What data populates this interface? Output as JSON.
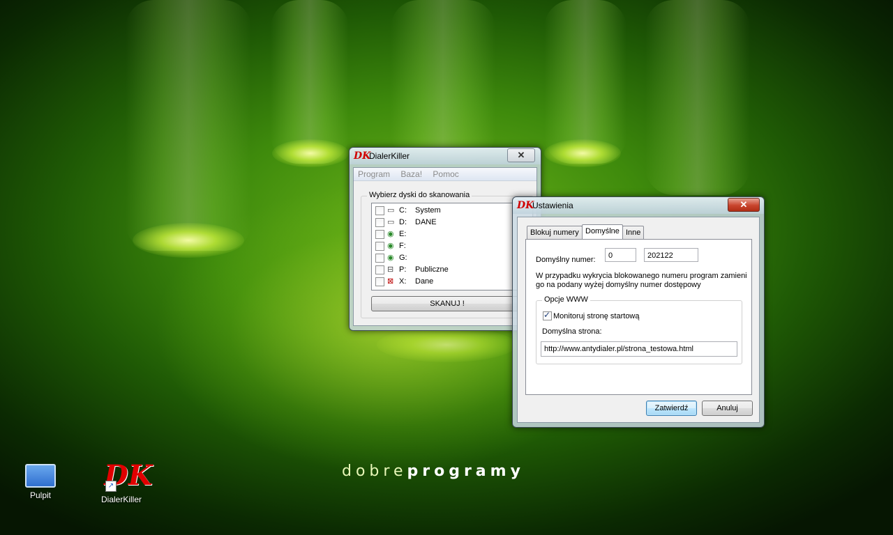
{
  "desktop": {
    "brand_light": "dobre",
    "brand_bold": "programy",
    "icons": [
      {
        "label": "Pulpit"
      },
      {
        "label": "DialerKiller"
      }
    ]
  },
  "main_window": {
    "title": "DialerKiller",
    "close_glyph": "✕",
    "menu": [
      "Program",
      "Baza!",
      "Pomoc"
    ],
    "group_label": "Wybierz dyski do skanowania",
    "drives": [
      {
        "letter": "C:",
        "label": "System",
        "icon": "hdd-icon"
      },
      {
        "letter": "D:",
        "label": "DANE",
        "icon": "hdd-icon"
      },
      {
        "letter": "E:",
        "label": "",
        "icon": "cdrom-icon"
      },
      {
        "letter": "F:",
        "label": "",
        "icon": "cdrom-icon"
      },
      {
        "letter": "G:",
        "label": "",
        "icon": "cdrom-icon"
      },
      {
        "letter": "P:",
        "label": "Publiczne",
        "icon": "network-drive-icon"
      },
      {
        "letter": "X:",
        "label": "Dane",
        "icon": "network-drive-icon"
      }
    ],
    "scan_button": "SKANUJ !"
  },
  "settings_window": {
    "title": "Ustawienia",
    "close_glyph": "✕",
    "tabs": [
      "Blokuj numery",
      "Domyślne",
      "Inne"
    ],
    "active_tab": "Domyślne",
    "default_number_label": "Domyślny numer:",
    "default_number_prefix": "0",
    "default_number_value": "202122",
    "description_line1": "W przypadku wykrycia blokowanego numeru program zamieni",
    "description_line2": "go na podany wyżej domyślny numer dostępowy",
    "www_group_label": "Opcje WWW",
    "monitor_checkbox_label": "Monitoruj stronę startową",
    "monitor_checked": true,
    "default_page_label": "Domyślna strona:",
    "default_page_url": "http://www.antydialer.pl/strona_testowa.html",
    "ok_button": "Zatwierdź",
    "cancel_button": "Anuluj"
  }
}
